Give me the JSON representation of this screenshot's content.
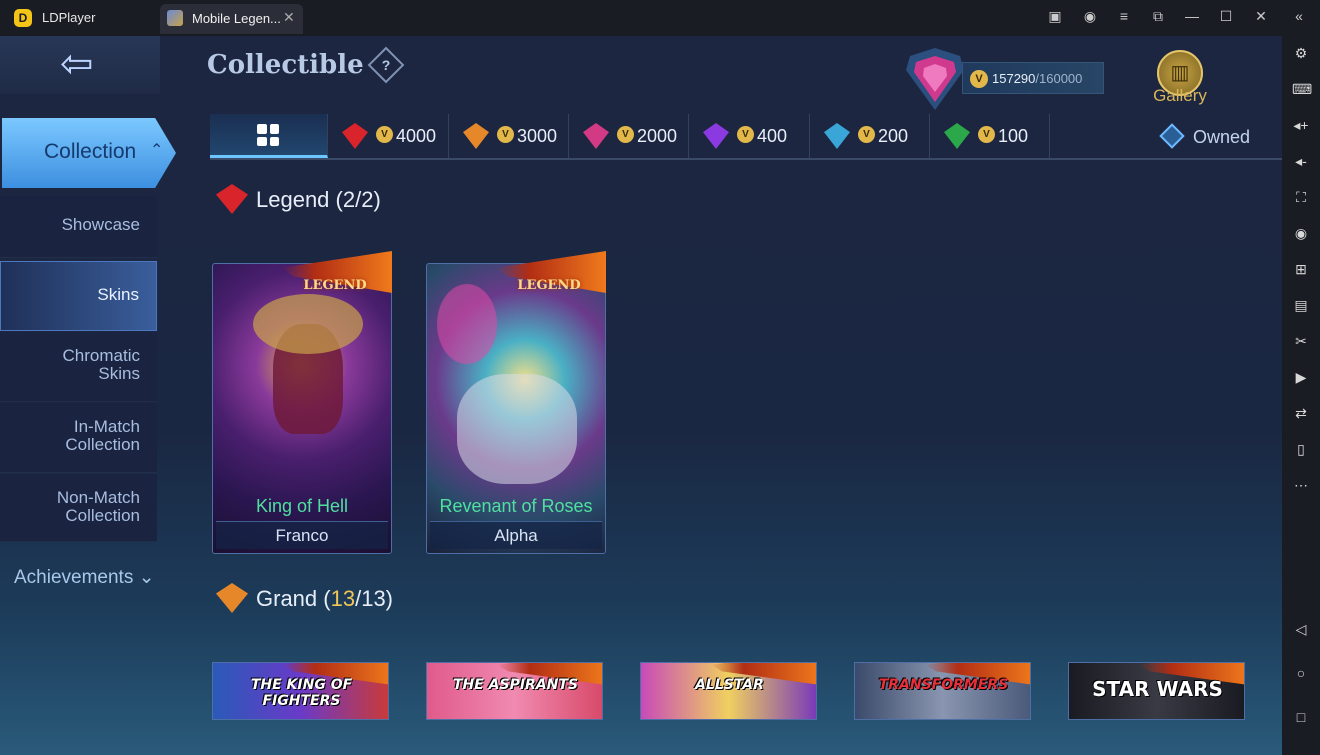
{
  "titlebar": {
    "app_name": "LDPlayer",
    "tab_title": "Mobile Legen...",
    "tab_close": "✕",
    "controls": [
      "▣",
      "◉",
      "≡",
      "⧉",
      "—",
      "☐",
      "✕"
    ]
  },
  "header": {
    "title": "Collectible",
    "help": "?",
    "points_current": "157290",
    "points_max": "/160000",
    "coin": "V",
    "gallery_label": "Gallery",
    "gallery_icon": "book-icon"
  },
  "menu": {
    "collection": "Collection",
    "collection_chevron": "⌃",
    "items": [
      {
        "label": "Showcase"
      },
      {
        "label": "Skins"
      },
      {
        "label": "Chromatic\nSkins"
      },
      {
        "label": "In-Match\nCollection"
      },
      {
        "label": "Non-Match\nCollection"
      }
    ],
    "achievements": "Achievements",
    "achievements_chevron": "⌄"
  },
  "filters": {
    "prices": [
      "4000",
      "3000",
      "2000",
      "400",
      "200",
      "100"
    ],
    "gem_colors": [
      "#d8242a",
      "#e6882a",
      "#d23a86",
      "#8a3ae0",
      "#3aa6d8",
      "#2aa84a"
    ],
    "owned": "Owned"
  },
  "legend_section": {
    "title": "Legend",
    "count_open": "(",
    "count_owned": "2",
    "count_total": "/2)"
  },
  "legend_cards": [
    {
      "badge": "LEGEND",
      "skin": "King of Hell",
      "hero": "Franco"
    },
    {
      "badge": "LEGEND",
      "skin": "Revenant of Roses",
      "hero": "Alpha"
    }
  ],
  "grand_section": {
    "title": "Grand",
    "count_open": "(",
    "count_owned": "13",
    "count_total": "/13)"
  },
  "grand_cards": [
    {
      "logo": "THE KING OF FIGHTERS"
    },
    {
      "logo": "THE ASPIRANTS"
    },
    {
      "logo": "ALLSTAR"
    },
    {
      "logo": "TRANSFORMERS"
    },
    {
      "logo": "STAR WARS"
    }
  ],
  "rightbar_icons": [
    "settings-icon",
    "keyboard-icon",
    "volume-up-icon",
    "volume-down-icon",
    "fullscreen-icon",
    "location-icon",
    "add-icon",
    "apk-icon",
    "scissors-icon",
    "record-icon",
    "sync-icon",
    "shake-icon",
    "more-icon",
    "back-nav-icon",
    "home-nav-icon",
    "recents-nav-icon"
  ]
}
